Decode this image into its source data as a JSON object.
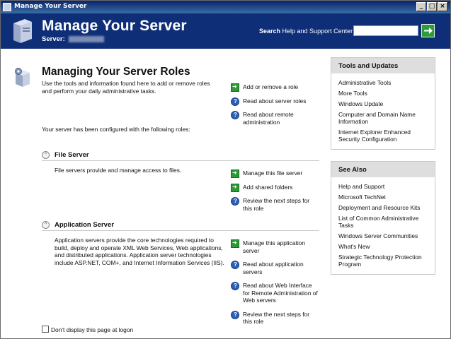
{
  "window": {
    "title": "Manage Your Server",
    "minimize": "_",
    "maximize": "□",
    "close": "×"
  },
  "header": {
    "title": "Manage Your Server",
    "server_label": "Server:",
    "search_bold": "Search",
    "search_rest": " Help and Support Center",
    "search_value": ""
  },
  "main": {
    "title": "Managing Your Server Roles",
    "intro": "Use the tools and information found here to add or remove roles and perform your daily administrative tasks.",
    "configured": "Your server has been configured with the following roles:",
    "top_tasks": [
      {
        "icon": "arrow",
        "label": "Add or remove a role"
      },
      {
        "icon": "help",
        "label": "Read about server roles"
      },
      {
        "icon": "help",
        "label": "Read about remote administration"
      }
    ],
    "roles": [
      {
        "name": "File Server",
        "collapse": "⌃",
        "description": "File servers provide and manage access to files.",
        "tasks": [
          {
            "icon": "arrow",
            "label": "Manage this file server"
          },
          {
            "icon": "arrow",
            "label": "Add shared folders"
          },
          {
            "icon": "help",
            "label": "Review the next steps for this role"
          }
        ]
      },
      {
        "name": "Application Server",
        "collapse": "⌃",
        "description": "Application servers provide the core technologies required to build, deploy and operate XML Web Services, Web applications, and distributed applications. Application server technologies include ASP.NET, COM+, and Internet Information Services (IIS).",
        "tasks": [
          {
            "icon": "arrow",
            "label": "Manage this application server"
          },
          {
            "icon": "help",
            "label": "Read about application servers"
          },
          {
            "icon": "help",
            "label": "Read about Web Interface for Remote Administration of Web servers"
          },
          {
            "icon": "help",
            "label": "Review the next steps for this role"
          }
        ]
      }
    ],
    "dont_display": "Don't display this page at logon"
  },
  "sidebar": {
    "tools": {
      "title": "Tools and Updates",
      "items": [
        "Administrative Tools",
        "More Tools",
        "Windows Update",
        "Computer and Domain Name Information",
        "Internet Explorer Enhanced Security Configuration"
      ]
    },
    "see_also": {
      "title": "See Also",
      "items": [
        "Help and Support",
        "Microsoft TechNet",
        "Deployment and Resource Kits",
        "List of Common Administrative Tasks",
        "Windows Server Communities",
        "What's New",
        "Strategic Technology Protection Program"
      ]
    }
  },
  "colors": {
    "header_bg": "#0f2e78",
    "go_green": "#2e9c3a",
    "panel_head": "#dedede"
  }
}
